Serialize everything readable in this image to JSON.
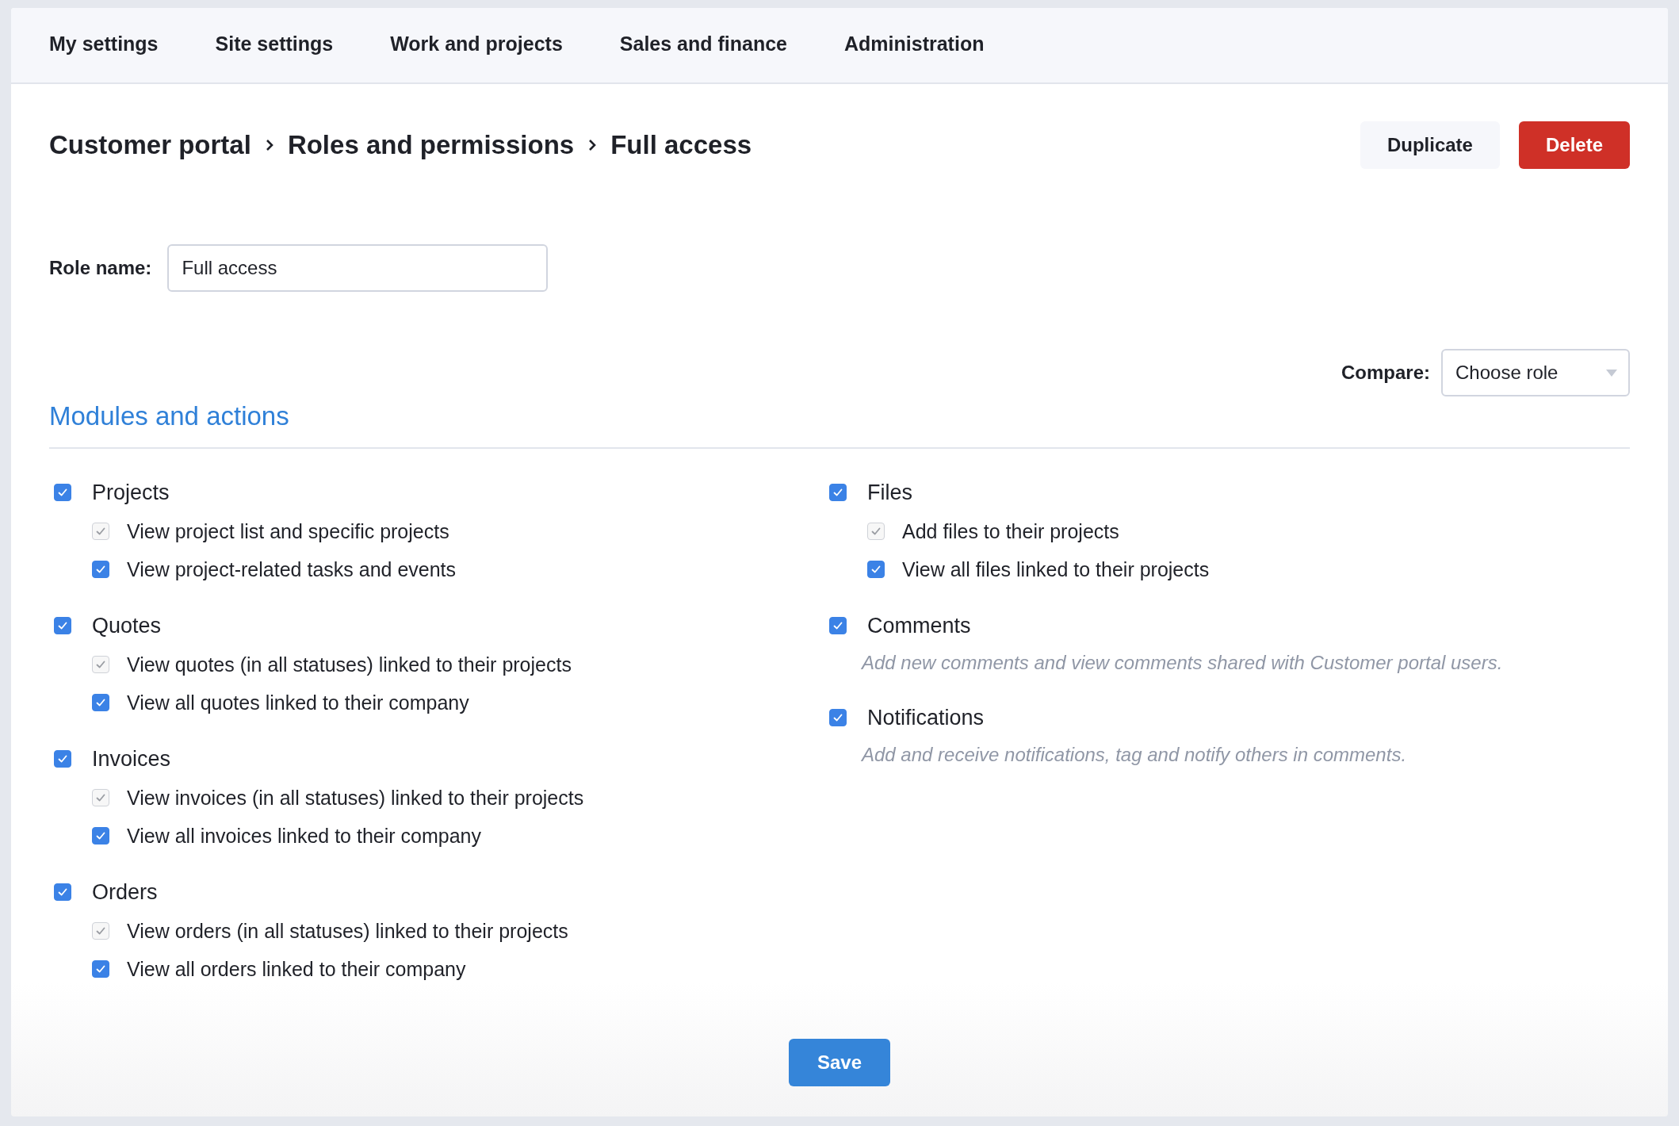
{
  "nav": {
    "items": [
      {
        "label": "My settings",
        "selected": false
      },
      {
        "label": "Site settings",
        "selected": false
      },
      {
        "label": "Work and projects",
        "selected": false
      },
      {
        "label": "Sales and finance",
        "selected": false
      },
      {
        "label": "Administration",
        "selected": false
      }
    ]
  },
  "breadcrumb": [
    "Customer portal",
    "Roles and permissions",
    "Full access"
  ],
  "actions": [
    {
      "label": "Duplicate",
      "kind": "secondary"
    },
    {
      "label": "Delete",
      "kind": "danger"
    }
  ],
  "role_name": {
    "label": "Role name:",
    "value": "Full access"
  },
  "compare": {
    "label": "Compare:",
    "placeholder": "Choose role"
  },
  "section_title": "Modules and actions",
  "columns": [
    [
      {
        "name": "Projects",
        "checked": true,
        "actions": [
          {
            "label": "View project list and specific projects",
            "checked": true,
            "disabled": true
          },
          {
            "label": "View project-related tasks and events",
            "checked": true,
            "disabled": false
          }
        ]
      },
      {
        "name": "Quotes",
        "checked": true,
        "actions": [
          {
            "label": "View quotes (in all statuses) linked to their projects",
            "checked": true,
            "disabled": true
          },
          {
            "label": "View all quotes linked to their company",
            "checked": true,
            "disabled": false
          }
        ]
      },
      {
        "name": "Invoices",
        "checked": true,
        "actions": [
          {
            "label": "View invoices (in all statuses) linked to their projects",
            "checked": true,
            "disabled": true
          },
          {
            "label": "View all invoices linked to their company",
            "checked": true,
            "disabled": false
          }
        ]
      },
      {
        "name": "Orders",
        "checked": true,
        "actions": [
          {
            "label": "View orders (in all statuses) linked to their projects",
            "checked": true,
            "disabled": true
          },
          {
            "label": "View all orders linked to their company",
            "checked": true,
            "disabled": false
          }
        ]
      }
    ],
    [
      {
        "name": "Files",
        "checked": true,
        "actions": [
          {
            "label": "Add files to their projects",
            "checked": true,
            "disabled": true
          },
          {
            "label": "View all files linked to their projects",
            "checked": true,
            "disabled": false
          }
        ]
      },
      {
        "name": "Comments",
        "checked": true,
        "description": "Add new comments and view comments shared with Customer portal users."
      },
      {
        "name": "Notifications",
        "checked": true,
        "description": "Add and receive notifications, tag and notify others in comments."
      }
    ]
  ],
  "save_button": "Save"
}
